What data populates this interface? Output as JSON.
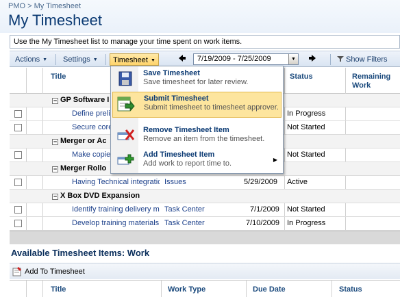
{
  "breadcrumb": "PMO > My Timesheet",
  "page_title": "My Timesheet",
  "description": "Use the My Timesheet list to manage your time spent on work items.",
  "toolbar": {
    "actions": "Actions",
    "settings": "Settings",
    "timesheet": "Timesheet",
    "date_range": "7/19/2009 - 7/25/2009",
    "show_filters": "Show Filters"
  },
  "columns": {
    "title": "Title",
    "status": "Status",
    "remaining_line1": "Remaining",
    "remaining_line2": "Work"
  },
  "rows": [
    {
      "type": "group",
      "title": "GP Software I"
    },
    {
      "type": "item",
      "title": "Define preli",
      "status": "In Progress"
    },
    {
      "type": "item",
      "title": "Secure core",
      "status": "Not Started"
    },
    {
      "type": "group",
      "title": "Merger or Ac"
    },
    {
      "type": "item",
      "title": "Make copies",
      "status": "Not Started"
    },
    {
      "type": "group",
      "title": "Merger Rollo"
    },
    {
      "type": "item",
      "title": "Having Technical integratio",
      "worktype": "Issues",
      "date": "5/29/2009",
      "status": "Active"
    },
    {
      "type": "group",
      "title": "X Box DVD Expansion"
    },
    {
      "type": "item",
      "title": "Identify training delivery m",
      "worktype": "Task Center",
      "date": "7/1/2009",
      "status": "Not Started"
    },
    {
      "type": "item",
      "title": "Develop training materials",
      "worktype": "Task Center",
      "date": "7/10/2009",
      "status": "In Progress"
    }
  ],
  "menu": {
    "items": [
      {
        "title": "Save Timesheet",
        "desc": "Save timesheet for later review.",
        "icon": "save-icon"
      },
      {
        "title": "Submit Timesheet",
        "desc": "Submit timesheet to timesheet approver.",
        "icon": "submit-icon"
      },
      {
        "title": "Remove Timesheet Item",
        "desc": "Remove an item from the timesheet.",
        "icon": "remove-icon"
      },
      {
        "title": "Add Timesheet Item",
        "desc": "Add work to report time to.",
        "icon": "add-icon"
      }
    ]
  },
  "available": {
    "heading": "Available Timesheet Items: Work",
    "add_label": "Add To Timesheet",
    "columns": {
      "title": "Title",
      "work_type": "Work Type",
      "due_date": "Due Date",
      "status": "Status"
    }
  },
  "colors": {
    "title_blue": "#0b3a73",
    "menu_highlight": "#fde59e"
  }
}
